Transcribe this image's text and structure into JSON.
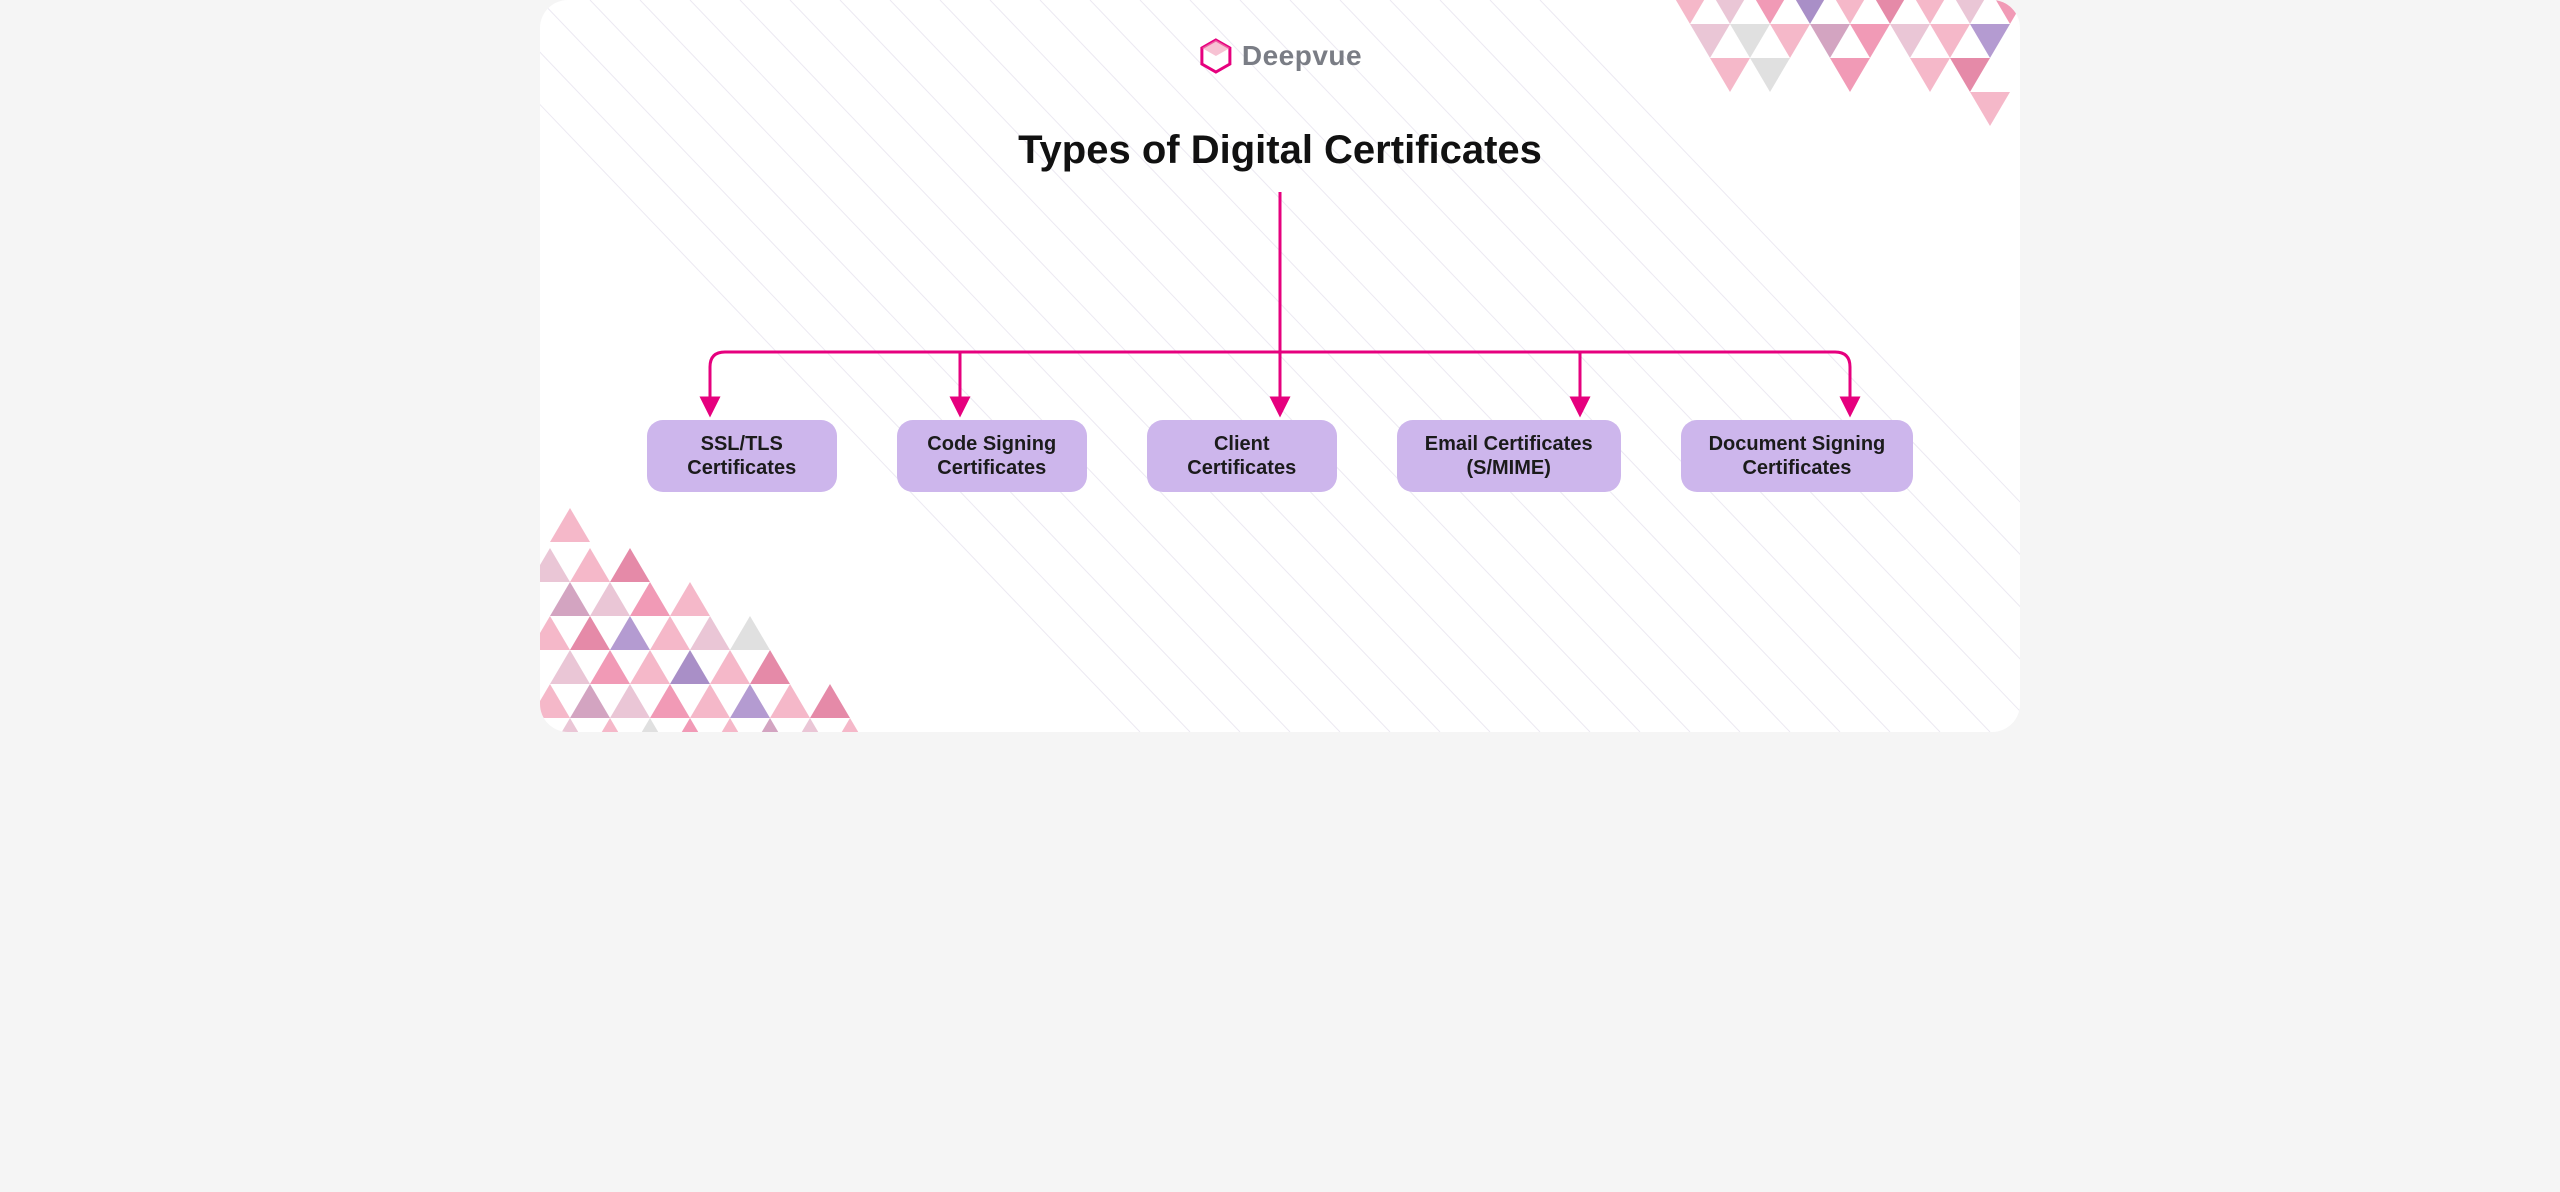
{
  "brand": {
    "name": "Deepvue"
  },
  "title": "Types of Digital Certificates",
  "nodes": [
    {
      "label": "SSL/TLS\nCertificates"
    },
    {
      "label": "Code Signing\nCertificates"
    },
    {
      "label": "Client\nCertificates"
    },
    {
      "label": "Email Certificates\n(S/MIME)"
    },
    {
      "label": "Document Signing\nCertificates"
    }
  ],
  "colors": {
    "accent": "#e6007e",
    "node_bg": "#cdb6ec"
  }
}
